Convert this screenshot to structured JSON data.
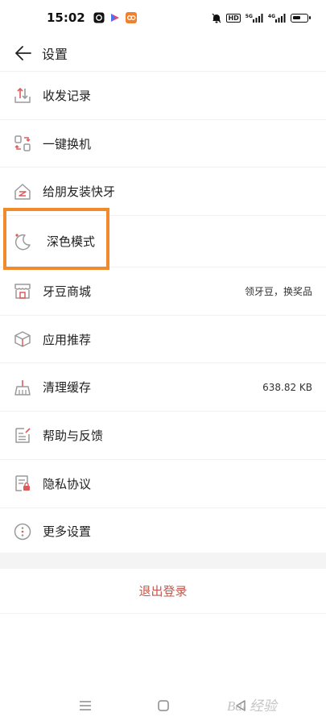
{
  "status_bar": {
    "time": "15:02",
    "hd_label": "HD",
    "signal1_label": "5G",
    "signal2_label": "4G"
  },
  "header": {
    "title": "设置"
  },
  "menu": {
    "items": [
      {
        "label": "收发记录",
        "icon": "send-receive-records-icon",
        "value": ""
      },
      {
        "label": "一键换机",
        "icon": "phone-switch-icon",
        "value": ""
      },
      {
        "label": "给朋友装快牙",
        "icon": "install-for-friend-icon",
        "value": ""
      },
      {
        "label": "深色模式",
        "icon": "moon-icon",
        "value": ""
      },
      {
        "label": "牙豆商城",
        "icon": "store-icon",
        "value": "领牙豆，换奖品"
      },
      {
        "label": "应用推荐",
        "icon": "app-box-icon",
        "value": ""
      },
      {
        "label": "清理缓存",
        "icon": "broom-icon",
        "value": "638.82 KB"
      },
      {
        "label": "帮助与反馈",
        "icon": "help-feedback-icon",
        "value": ""
      },
      {
        "label": "隐私协议",
        "icon": "privacy-doc-icon",
        "value": ""
      },
      {
        "label": "更多设置",
        "icon": "more-dots-icon",
        "value": ""
      }
    ]
  },
  "logout": {
    "label": "退出登录"
  },
  "colors": {
    "icon_stroke": "#9a9a9a",
    "icon_accent": "#e05a5a",
    "highlight": "#f08a2d",
    "logout_text": "#c0584f"
  },
  "watermark": {
    "text": "Bai 经验"
  }
}
